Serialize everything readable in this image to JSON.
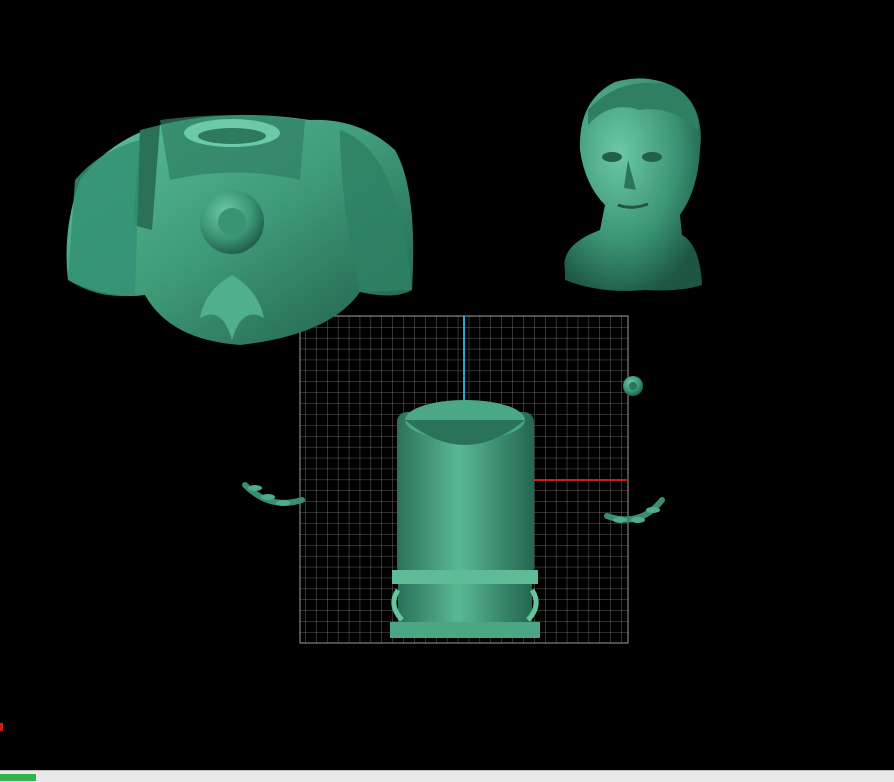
{
  "viewport": {
    "background": "#000000",
    "model_color": "#3f9a79",
    "grid_color": "#8a8a8a",
    "y_axis_color": "#2aa6c8",
    "x_axis_color": "#c81e1e"
  },
  "objects": [
    "cuirass-model",
    "head-bust-model",
    "pedestal-column-model",
    "laurel-left-model",
    "laurel-right-model",
    "rosette-model"
  ],
  "statusbar": {
    "progress_fraction": 0.04,
    "progress_color": "#33b24a"
  }
}
